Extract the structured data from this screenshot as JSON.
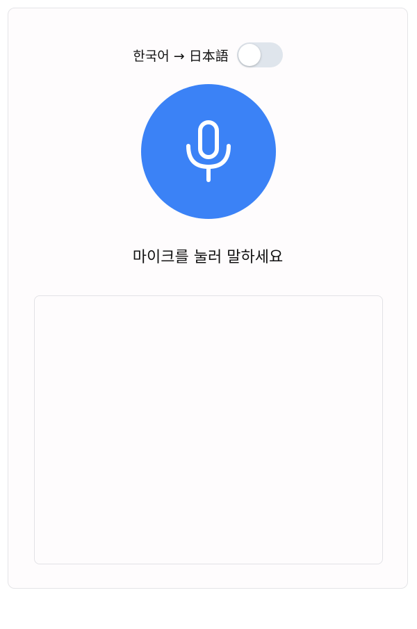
{
  "language": {
    "label": "한국어 → 日本語",
    "toggle_on": false
  },
  "mic": {
    "icon": "microphone-icon",
    "color": "#3b82f6"
  },
  "status": {
    "text": "마이크를 눌러 말하세요"
  },
  "transcript": {
    "text": ""
  }
}
